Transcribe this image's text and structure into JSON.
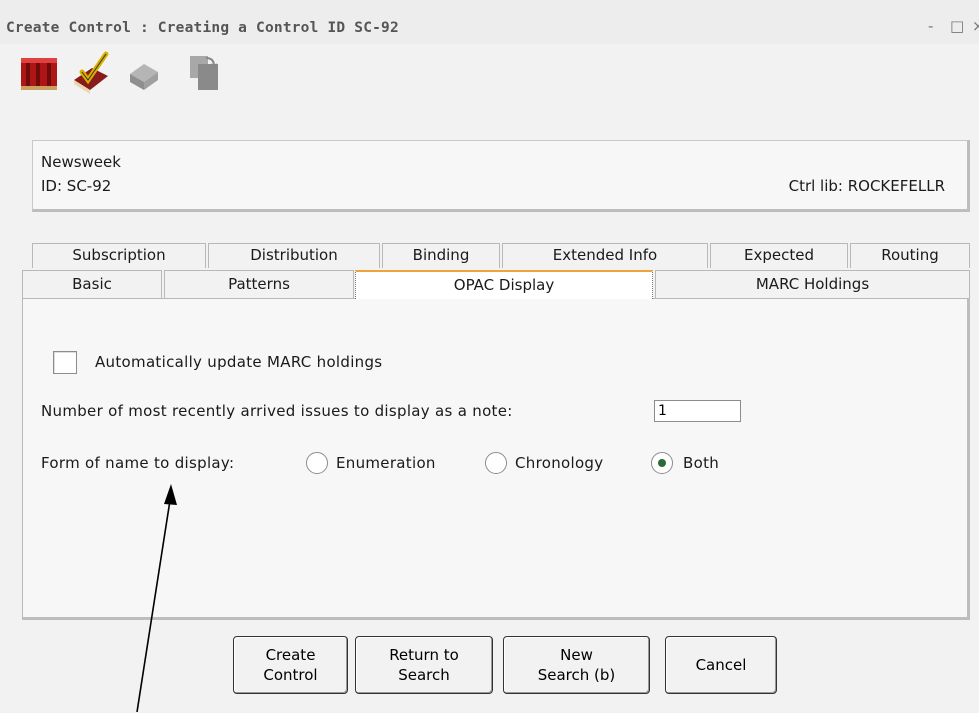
{
  "window": {
    "title": "Create Control : Creating a Control ID SC-92",
    "minimize": "-",
    "maximize": "□",
    "close": "×"
  },
  "toolbar": {
    "icons": [
      "books-icon",
      "checkmark-icon",
      "copy-icon",
      "paste-icon"
    ]
  },
  "info": {
    "name": "Newsweek",
    "id": "ID: SC-92",
    "ctrl_lib": "Ctrl lib: ROCKEFELLR"
  },
  "tabs": {
    "back": [
      "Subscription",
      "Distribution",
      "Binding",
      "Extended Info",
      "Expected",
      "Routing"
    ],
    "front": [
      "Basic",
      "Patterns",
      "OPAC Display",
      "MARC Holdings"
    ],
    "active": "OPAC Display"
  },
  "panel": {
    "auto_update_label": "Automatically update MARC holdings",
    "auto_update_checked": false,
    "recent_label": "Number of most recently arrived issues to display as a note:",
    "recent_value": "1",
    "form_label": "Form of name to display:",
    "options": [
      "Enumeration",
      "Chronology",
      "Both"
    ],
    "selected_option": "Both"
  },
  "buttons": {
    "create": [
      "Create",
      "Control"
    ],
    "return": [
      "Return to",
      "Search"
    ],
    "new_search": [
      "New",
      "Search (b)"
    ],
    "cancel": "Cancel"
  },
  "colors": {
    "active_tab_accent": "#f0a33a",
    "radio_dot": "#2d6a36"
  }
}
